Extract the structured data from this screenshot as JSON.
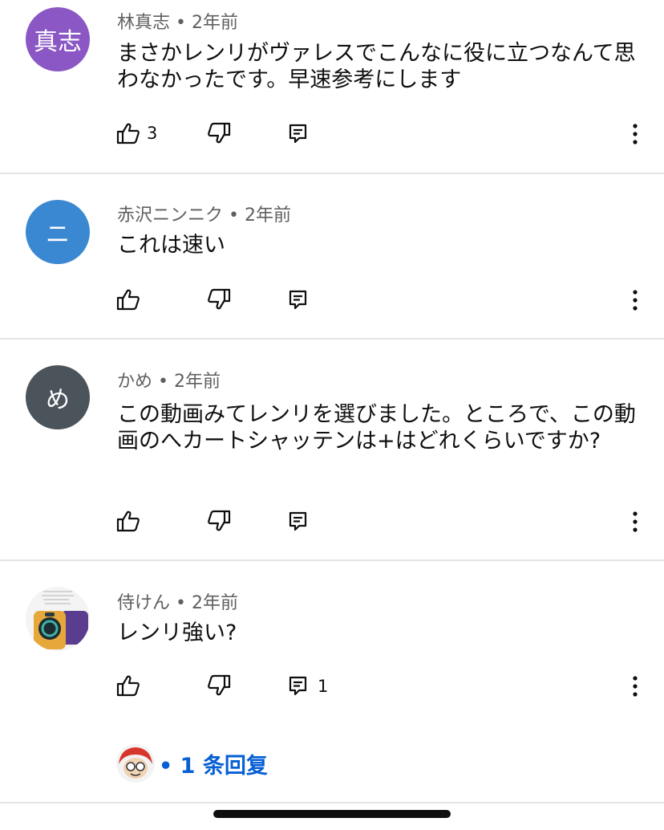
{
  "comments": [
    {
      "avatar_text": "真志",
      "avatar_color": "#8a57c4",
      "author": "林真志",
      "time": "2年前",
      "text": "まさかレンリがヴァレスでこんなに役に立つなんて思わなかったです。早速参考にします",
      "likes": "3",
      "replies": ""
    },
    {
      "avatar_text": "ニ",
      "avatar_color": "#3b88d2",
      "author": "赤沢ニンニク",
      "time": "2年前",
      "text": "これは速い",
      "likes": "",
      "replies": ""
    },
    {
      "avatar_text": "め",
      "avatar_color": "#4b535b",
      "author": "かめ",
      "time": "2年前",
      "text": "この動画みてレンリを選びました。ところで、この動画のへカートシャッテンは+はどれくらいですか?",
      "likes": "",
      "replies": ""
    },
    {
      "avatar_text": "",
      "avatar_color": "#f2f2f2",
      "author": "侍けん",
      "time": "2年前",
      "text": "レンリ強い?",
      "likes": "",
      "replies": "1"
    }
  ],
  "meta_separator": "•",
  "replies_link": "• 1 条回复",
  "colors": {
    "link": "#065fd4",
    "divider": "#e5e5e5",
    "meta": "#606060"
  }
}
